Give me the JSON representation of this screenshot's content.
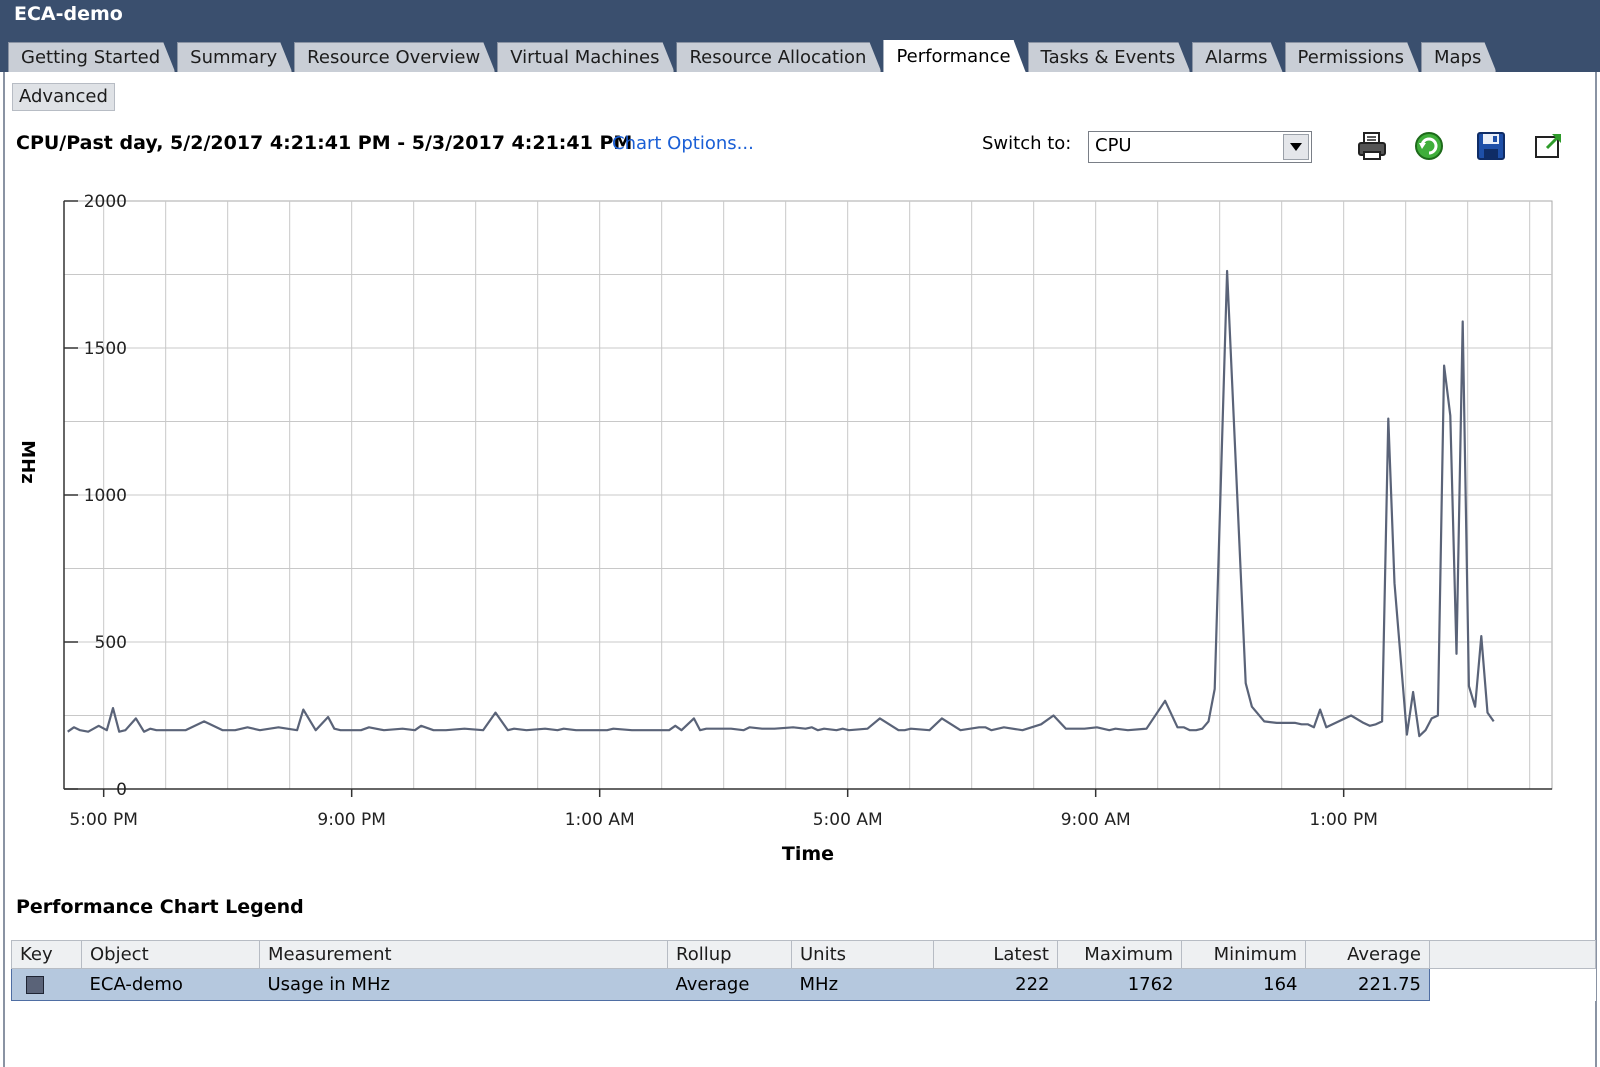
{
  "window": {
    "title": "ECA-demo"
  },
  "tabs": [
    {
      "label": "Getting Started"
    },
    {
      "label": "Summary"
    },
    {
      "label": "Resource Overview"
    },
    {
      "label": "Virtual Machines"
    },
    {
      "label": "Resource Allocation"
    },
    {
      "label": "Performance",
      "active": true
    },
    {
      "label": "Tasks & Events"
    },
    {
      "label": "Alarms"
    },
    {
      "label": "Permissions"
    },
    {
      "label": "Maps"
    }
  ],
  "toolbar": {
    "advanced_label": "Advanced",
    "chart_heading": "CPU/Past day, 5/2/2017 4:21:41 PM - 5/3/2017 4:21:41 PM",
    "chart_options_label": "Chart Options...",
    "switch_to_label": "Switch to:",
    "switch_to_value": "CPU",
    "icons": [
      "print-icon",
      "refresh-icon",
      "save-icon",
      "export-icon"
    ]
  },
  "chart_data": {
    "type": "line",
    "xlabel": "Time",
    "ylabel": "MHz",
    "ylim": [
      0,
      2000
    ],
    "yticks": [
      0,
      500,
      1000,
      1500,
      2000
    ],
    "xlim_hours": [
      16.36,
      40.36
    ],
    "xtick_labels": [
      "5:00 PM",
      "9:00 PM",
      "1:00 AM",
      "5:00 AM",
      "9:00 AM",
      "1:00 PM"
    ],
    "xtick_hours": [
      17,
      21,
      25,
      29,
      33,
      37
    ],
    "grid": true,
    "line_color": "#5a6378",
    "series": [
      {
        "name": "ECA-demo",
        "x_hours": [
          16.42,
          16.52,
          16.62,
          16.75,
          16.92,
          17.05,
          17.15,
          17.25,
          17.35,
          17.52,
          17.65,
          17.75,
          17.85,
          17.95,
          18.12,
          18.32,
          18.62,
          18.92,
          19.02,
          19.12,
          19.32,
          19.52,
          19.82,
          20.12,
          20.22,
          20.42,
          20.62,
          20.72,
          20.82,
          20.92,
          21.05,
          21.15,
          21.28,
          21.52,
          21.82,
          22.02,
          22.12,
          22.32,
          22.42,
          22.52,
          22.82,
          23.12,
          23.32,
          23.52,
          23.62,
          23.82,
          24.12,
          24.32,
          24.42,
          24.62,
          24.82,
          25.12,
          25.22,
          25.52,
          25.82,
          26.12,
          26.22,
          26.32,
          26.52,
          26.62,
          26.72,
          26.82,
          27.12,
          27.32,
          27.42,
          27.62,
          27.82,
          28.12,
          28.32,
          28.42,
          28.52,
          28.62,
          28.82,
          28.92,
          29.02,
          29.32,
          29.52,
          29.82,
          29.92,
          30.02,
          30.32,
          30.52,
          30.82,
          31.12,
          31.22,
          31.32,
          31.52,
          31.82,
          32.12,
          32.32,
          32.52,
          32.82,
          33.02,
          33.22,
          33.32,
          33.52,
          33.82,
          34.12,
          34.32,
          34.42,
          34.52,
          34.62,
          34.72,
          34.82,
          34.92,
          35.12,
          35.42,
          35.52,
          35.72,
          35.92,
          36.22,
          36.32,
          36.42,
          36.52,
          36.62,
          36.72,
          36.92,
          37.12,
          37.32,
          37.42,
          37.52,
          37.62,
          37.72,
          37.82,
          38.02,
          38.12,
          38.22,
          38.32,
          38.42,
          38.52,
          38.62,
          38.72,
          38.82,
          38.92,
          39.02,
          39.12,
          39.22,
          39.32,
          39.42,
          39.52,
          39.62,
          39.72,
          39.82,
          39.92,
          40.02,
          40.12,
          40.22
        ],
        "values": [
          195,
          210,
          200,
          195,
          215,
          200,
          275,
          195,
          200,
          240,
          195,
          205,
          200,
          200,
          200,
          200,
          230,
          200,
          200,
          200,
          210,
          200,
          210,
          200,
          270,
          200,
          245,
          205,
          200,
          200,
          200,
          200,
          210,
          200,
          205,
          200,
          215,
          200,
          200,
          200,
          205,
          200,
          260,
          200,
          205,
          200,
          205,
          200,
          205,
          200,
          200,
          200,
          205,
          200,
          200,
          200,
          215,
          200,
          240,
          200,
          205,
          205,
          205,
          200,
          210,
          205,
          205,
          210,
          205,
          210,
          200,
          205,
          200,
          205,
          200,
          205,
          240,
          200,
          200,
          205,
          200,
          240,
          200,
          210,
          210,
          200,
          210,
          200,
          220,
          250,
          205,
          205,
          210,
          200,
          205,
          200,
          205,
          300,
          210,
          210,
          200,
          200,
          205,
          230,
          340,
          1762,
          360,
          280,
          230,
          225,
          225,
          220,
          220,
          210,
          270,
          210,
          230,
          250,
          225,
          215,
          220,
          230,
          1260,
          700,
          185,
          330,
          180,
          200,
          240,
          250,
          1440,
          1270,
          460,
          1590,
          350,
          280,
          520,
          260,
          230
        ],
        "note": "values estimated from chart"
      }
    ]
  },
  "legend": {
    "title": "Performance Chart Legend",
    "columns": [
      "Key",
      "Object",
      "Measurement",
      "Rollup",
      "Units",
      "Latest",
      "Maximum",
      "Minimum",
      "Average"
    ],
    "rows": [
      {
        "key_color": "#5a6378",
        "object": "ECA-demo",
        "measurement": "Usage in MHz",
        "rollup": "Average",
        "units": "MHz",
        "latest": "222",
        "maximum": "1762",
        "minimum": "164",
        "average": "221.75"
      }
    ]
  }
}
